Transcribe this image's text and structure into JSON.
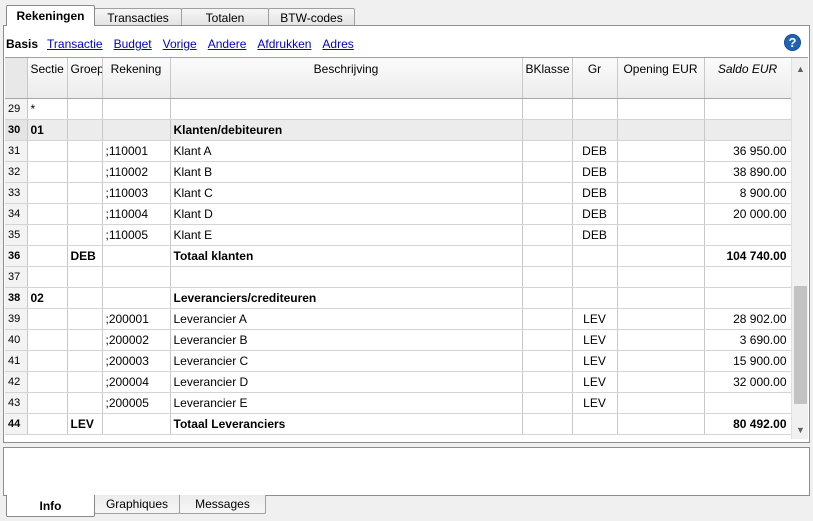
{
  "top_tabs": [
    "Rekeningen",
    "Transacties",
    "Totalen",
    "BTW-codes"
  ],
  "subnav": {
    "active": "Basis",
    "links": [
      "Transactie",
      "Budget",
      "Vorige",
      "Andere",
      "Afdrukken",
      "Adres"
    ]
  },
  "help_icon": "?",
  "table": {
    "headers": [
      "Sectie",
      "Groep",
      "Rekening",
      "Beschrijving",
      "BKlasse",
      "Gr",
      "Opening EUR",
      "Saldo EUR"
    ],
    "rows": [
      {
        "n": "29",
        "sectie": "*",
        "groep": "",
        "rekening": "",
        "beschrijving": "",
        "bklasse": "",
        "gr": "",
        "opening": "",
        "saldo": ""
      },
      {
        "n": "30",
        "sectie": "01",
        "groep": "",
        "rekening": "",
        "beschrijving": "Klanten/debiteuren",
        "bklasse": "",
        "gr": "",
        "opening": "",
        "saldo": ""
      },
      {
        "n": "31",
        "sectie": "",
        "groep": "",
        "rekening": ";110001",
        "beschrijving": "Klant A",
        "bklasse": "",
        "gr": "DEB",
        "opening": "",
        "saldo": "36 950.00"
      },
      {
        "n": "32",
        "sectie": "",
        "groep": "",
        "rekening": ";110002",
        "beschrijving": "Klant B",
        "bklasse": "",
        "gr": "DEB",
        "opening": "",
        "saldo": "38 890.00"
      },
      {
        "n": "33",
        "sectie": "",
        "groep": "",
        "rekening": ";110003",
        "beschrijving": "Klant C",
        "bklasse": "",
        "gr": "DEB",
        "opening": "",
        "saldo": "8 900.00"
      },
      {
        "n": "34",
        "sectie": "",
        "groep": "",
        "rekening": ";110004",
        "beschrijving": "Klant D",
        "bklasse": "",
        "gr": "DEB",
        "opening": "",
        "saldo": "20 000.00"
      },
      {
        "n": "35",
        "sectie": "",
        "groep": "",
        "rekening": ";110005",
        "beschrijving": "Klant E",
        "bklasse": "",
        "gr": "DEB",
        "opening": "",
        "saldo": ""
      },
      {
        "n": "36",
        "sectie": "",
        "groep": "DEB",
        "rekening": "",
        "beschrijving": "Totaal klanten",
        "bklasse": "",
        "gr": "",
        "opening": "",
        "saldo": "104 740.00"
      },
      {
        "n": "37",
        "sectie": "",
        "groep": "",
        "rekening": "",
        "beschrijving": "",
        "bklasse": "",
        "gr": "",
        "opening": "",
        "saldo": ""
      },
      {
        "n": "38",
        "sectie": "02",
        "groep": "",
        "rekening": "",
        "beschrijving": "Leveranciers/crediteuren",
        "bklasse": "",
        "gr": "",
        "opening": "",
        "saldo": ""
      },
      {
        "n": "39",
        "sectie": "",
        "groep": "",
        "rekening": ";200001",
        "beschrijving": "Leverancier A",
        "bklasse": "",
        "gr": "LEV",
        "opening": "",
        "saldo": "28 902.00"
      },
      {
        "n": "40",
        "sectie": "",
        "groep": "",
        "rekening": ";200002",
        "beschrijving": "Leverancier B",
        "bklasse": "",
        "gr": "LEV",
        "opening": "",
        "saldo": "3 690.00"
      },
      {
        "n": "41",
        "sectie": "",
        "groep": "",
        "rekening": ";200003",
        "beschrijving": "Leverancier C",
        "bklasse": "",
        "gr": "LEV",
        "opening": "",
        "saldo": "15 900.00"
      },
      {
        "n": "42",
        "sectie": "",
        "groep": "",
        "rekening": ";200004",
        "beschrijving": "Leverancier D",
        "bklasse": "",
        "gr": "LEV",
        "opening": "",
        "saldo": "32 000.00"
      },
      {
        "n": "43",
        "sectie": "",
        "groep": "",
        "rekening": ";200005",
        "beschrijving": "Leverancier E",
        "bklasse": "",
        "gr": "LEV",
        "opening": "",
        "saldo": ""
      },
      {
        "n": "44",
        "sectie": "",
        "groep": "LEV",
        "rekening": "",
        "beschrijving": "Totaal Leveranciers",
        "bklasse": "",
        "gr": "",
        "opening": "",
        "saldo": "80 492.00"
      }
    ]
  },
  "bottom_tabs": [
    "Info",
    "Graphiques",
    "Messages"
  ]
}
